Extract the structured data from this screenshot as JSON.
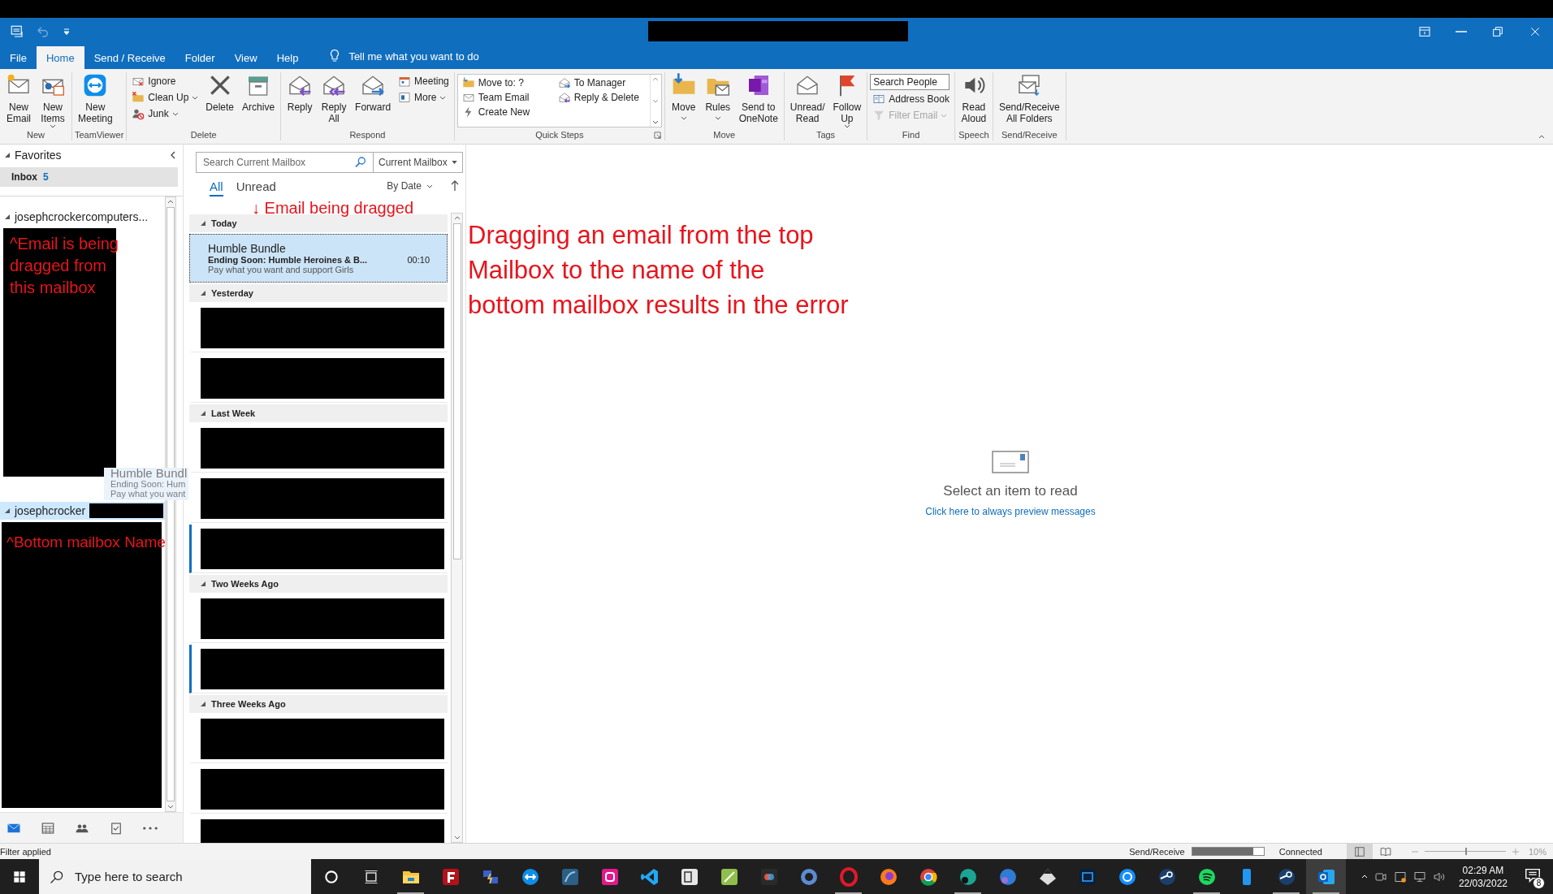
{
  "title_bar": {
    "undo": {
      "disabled": true
    }
  },
  "ribbon": {
    "tabs": [
      {
        "label": "File",
        "selected": false
      },
      {
        "label": "Home",
        "selected": true
      },
      {
        "label": "Send / Receive",
        "selected": false
      },
      {
        "label": "Folder",
        "selected": false
      },
      {
        "label": "View",
        "selected": false
      },
      {
        "label": "Help",
        "selected": false
      }
    ],
    "tell_me": "Tell me what you want to do",
    "groups": [
      {
        "name": "New",
        "items": [
          {
            "kind": "large",
            "lines": [
              "New",
              "Email"
            ],
            "dropdown": false
          },
          {
            "kind": "large",
            "lines": [
              "New",
              "Items"
            ],
            "dropdown": true
          }
        ]
      },
      {
        "name": "TeamViewer",
        "items": [
          {
            "kind": "large",
            "lines": [
              "New",
              "Meeting"
            ],
            "dropdown": false
          }
        ]
      },
      {
        "name": "Delete",
        "items": [
          {
            "kind": "stack",
            "items": [
              {
                "kind": "button",
                "label": "Ignore",
                "dropdown": false,
                "disabled": false
              },
              {
                "kind": "button",
                "label": "Clean Up",
                "dropdown": true,
                "disabled": false
              },
              {
                "kind": "button",
                "label": "Junk",
                "dropdown": true,
                "disabled": false
              }
            ]
          },
          {
            "kind": "large",
            "lines": [
              "Delete"
            ],
            "dropdown": false
          },
          {
            "kind": "large",
            "lines": [
              "Archive"
            ],
            "dropdown": false
          }
        ]
      },
      {
        "name": "Respond",
        "items": [
          {
            "kind": "large",
            "lines": [
              "Reply"
            ],
            "dropdown": false
          },
          {
            "kind": "large",
            "lines": [
              "Reply",
              "All"
            ],
            "dropdown": false
          },
          {
            "kind": "large",
            "lines": [
              "Forward"
            ],
            "dropdown": false
          },
          {
            "kind": "stack",
            "items": [
              {
                "kind": "button",
                "label": "Meeting",
                "dropdown": false,
                "disabled": false
              },
              {
                "kind": "button",
                "label": "More",
                "dropdown": true,
                "disabled": false
              }
            ]
          }
        ]
      },
      {
        "name": "Quick Steps",
        "launcher": true,
        "items": [
          {
            "kind": "gallery",
            "columns": [
              [
                "Move to: ?",
                "Team Email",
                "Create New"
              ],
              [
                "To Manager",
                "Reply & Delete"
              ]
            ]
          }
        ]
      },
      {
        "name": "Move",
        "items": [
          {
            "kind": "large",
            "lines": [
              "Move"
            ],
            "dropdown": true
          },
          {
            "kind": "large",
            "lines": [
              "Rules"
            ],
            "dropdown": true
          },
          {
            "kind": "large",
            "lines": [
              "Send to",
              "OneNote"
            ],
            "dropdown": false
          }
        ]
      },
      {
        "name": "Tags",
        "items": [
          {
            "kind": "large",
            "lines": [
              "Unread/",
              "Read"
            ],
            "dropdown": false
          },
          {
            "kind": "large",
            "lines": [
              "Follow",
              "Up"
            ],
            "dropdown": true
          }
        ]
      },
      {
        "name": "Find",
        "items": [
          {
            "kind": "stack",
            "items": [
              {
                "kind": "field",
                "placeholder": "Search People"
              },
              {
                "kind": "button",
                "label": "Address Book",
                "dropdown": false,
                "disabled": false
              },
              {
                "kind": "button",
                "label": "Filter Email",
                "dropdown": true,
                "disabled": true
              }
            ]
          }
        ]
      },
      {
        "name": "Speech",
        "items": [
          {
            "kind": "large",
            "lines": [
              "Read",
              "Aloud"
            ],
            "dropdown": false
          }
        ]
      },
      {
        "name": "Send/Receive",
        "items": [
          {
            "kind": "large",
            "lines": [
              "Send/Receive",
              "All Folders"
            ],
            "dropdown": false
          }
        ]
      }
    ]
  },
  "folder_pane": {
    "favorites": {
      "label": "Favorites",
      "expanded": true,
      "items": [
        {
          "name": "Inbox",
          "count": "5",
          "selected": true
        }
      ]
    },
    "accounts": [
      {
        "name": "josephcrockercomputers...",
        "expanded": true,
        "drop_target": false,
        "annotation": "^Email is being dragged from this mailbox"
      },
      {
        "name": "josephcrocker",
        "expanded": true,
        "drop_target": true,
        "annotation": "^Bottom mailbox Name"
      }
    ],
    "nav": [
      {
        "selected": true
      },
      {
        "selected": false
      },
      {
        "selected": false
      },
      {
        "selected": false
      },
      {
        "selected": false
      }
    ]
  },
  "drag_ghost": {
    "lines": [
      "Humble Bundl",
      "Ending Soon: Hum",
      "Pay what you want"
    ]
  },
  "message_list": {
    "search": {
      "placeholder": "Search Current Mailbox"
    },
    "scope": "Current Mailbox",
    "filters": [
      {
        "label": "All",
        "selected": true
      },
      {
        "label": "Unread",
        "selected": false
      }
    ],
    "sort": "By Date",
    "annotation": "↓ Email being dragged",
    "groups": [
      {
        "label": "Today",
        "expanded": true,
        "items": [
          {
            "redacted": false,
            "selected": true,
            "unread": false,
            "sender": "Humble Bundle",
            "subject": "Ending Soon: Humble Heroines & B...",
            "time": "00:10",
            "preview": "Pay what you want and support Girls"
          }
        ]
      },
      {
        "label": "Yesterday",
        "expanded": true,
        "items": [
          {
            "redacted": true,
            "selected": false,
            "unread": false
          },
          {
            "redacted": true,
            "selected": false,
            "unread": false
          }
        ]
      },
      {
        "label": "Last Week",
        "expanded": true,
        "items": [
          {
            "redacted": true,
            "selected": false,
            "unread": false
          },
          {
            "redacted": true,
            "selected": false,
            "unread": false
          },
          {
            "redacted": true,
            "selected": false,
            "unread": true
          }
        ]
      },
      {
        "label": "Two Weeks Ago",
        "expanded": true,
        "items": [
          {
            "redacted": true,
            "selected": false,
            "unread": false
          },
          {
            "redacted": true,
            "selected": false,
            "unread": true
          }
        ]
      },
      {
        "label": "Three Weeks Ago",
        "expanded": true,
        "items": [
          {
            "redacted": true,
            "selected": false,
            "unread": false
          },
          {
            "redacted": true,
            "selected": false,
            "unread": false
          },
          {
            "redacted": true,
            "selected": false,
            "unread": false
          }
        ]
      }
    ]
  },
  "reading_pane": {
    "annotation": "Dragging an email from the top\nMailbox to the name of the\nbottom mailbox results in the error",
    "empty_text": "Select an item to read",
    "link": "Click here to always preview messages"
  },
  "status_bar": {
    "left": "Filter applied",
    "sync": {
      "label": "Send/Receive",
      "level": 0.85
    },
    "connection": "Connected",
    "views": [
      {
        "selected": true
      },
      {
        "selected": false
      }
    ],
    "zoom": {
      "level": 0.5,
      "reading": "10%"
    }
  },
  "taskbar": {
    "search_placeholder": "Type here to search",
    "apps": [
      {
        "running": false,
        "active": false
      },
      {
        "running": false,
        "active": false
      },
      {
        "running": true,
        "active": false
      },
      {
        "running": false,
        "active": false
      },
      {
        "running": false,
        "active": false
      },
      {
        "running": false,
        "active": false
      },
      {
        "running": false,
        "active": false
      },
      {
        "running": false,
        "active": false
      },
      {
        "running": false,
        "active": false
      },
      {
        "running": false,
        "active": false
      },
      {
        "running": false,
        "active": false
      },
      {
        "running": false,
        "active": false
      },
      {
        "running": false,
        "active": false
      },
      {
        "running": true,
        "active": false
      },
      {
        "running": false,
        "active": false
      },
      {
        "running": false,
        "active": false
      },
      {
        "running": true,
        "active": false
      },
      {
        "running": false,
        "active": false
      },
      {
        "running": false,
        "active": false
      },
      {
        "running": false,
        "active": false
      },
      {
        "running": false,
        "active": false
      },
      {
        "running": false,
        "active": false
      },
      {
        "running": true,
        "active": false
      },
      {
        "running": false,
        "active": false
      },
      {
        "running": true,
        "active": false
      },
      {
        "running": true,
        "active": true
      }
    ],
    "time": "02:29 AM",
    "date": "22/03/2022",
    "notifications": "8"
  }
}
